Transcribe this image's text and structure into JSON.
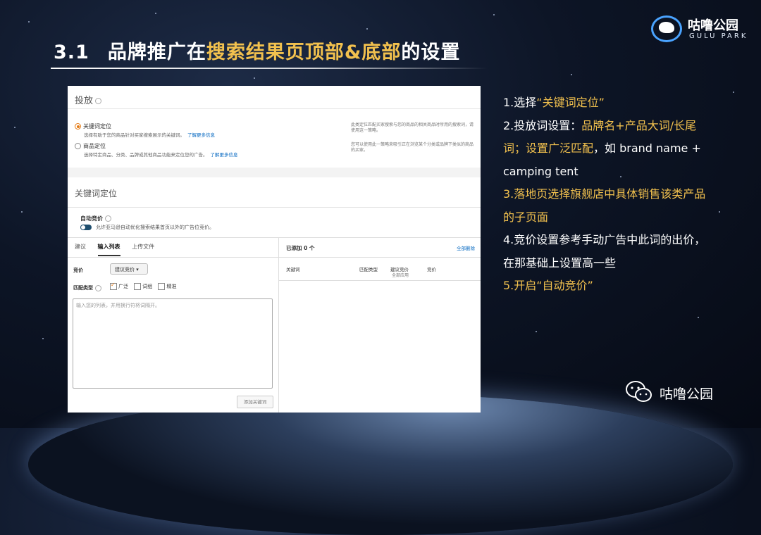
{
  "slide": {
    "title_num": "3.1",
    "title_a": "品牌推广在",
    "title_hl": "搜索结果页顶部&底部",
    "title_b": "的设置"
  },
  "logo": {
    "name": "咕噜公园",
    "sub": "GULU PARK"
  },
  "targeting": {
    "heading": "投放",
    "opt1_label": "关键词定位",
    "opt1_desc": "选择有助于您的商品针对买家搜索展示的关键词。",
    "opt2_label": "商品定位",
    "opt2_desc": "选择特定商品、分类、品牌或其他商品功能来定位您的广告。",
    "learn_more": "了解更多信息",
    "note1": "此类定位匹配买家搜索与您的商品的相关商品时所用的搜索词，请使用这一策略。",
    "note2": "您可以使用此一策略来吸引正在浏览某个分类或品牌下类似的商品的买家。"
  },
  "keyword": {
    "heading": "关键词定位",
    "autobid_label": "自动竞价",
    "autobid_desc": "允许亚马逊自动优化搜索结果首页以外的广告位竞价。",
    "tabs": [
      "建议",
      "输入列表",
      "上传文件"
    ],
    "bid_label": "竞价",
    "bid_value": "建议竞价",
    "match_label": "匹配类型",
    "match_types": [
      "广泛",
      "词组",
      "精准"
    ],
    "textarea_placeholder": "输入您的列表，并用换行符将词隔开。",
    "add_button": "添加关键词",
    "added_label": "已添加 0 个",
    "remove_all": "全部删除",
    "columns": [
      "关键词",
      "匹配类型",
      "建议竞价",
      "竞价"
    ],
    "col_sub": "全部应用"
  },
  "steps": {
    "s1_a": "1.选择",
    "s1_b": "“关键词定位”",
    "s2_a": "2.投放词设置：",
    "s2_b": "品牌名+产品大词/长尾词；设置广泛匹配",
    "s2_c": "，如 brand name + camping tent",
    "s3": "3.落地页选择旗舰店中具体销售该类产品的子页面",
    "s4": "4.竞价设置参考手动广告中此词的出价，在那基础上设置高一些",
    "s5": "5.开启“自动竞价”"
  },
  "footer": {
    "brand": "咕噜公园"
  },
  "colors": {
    "accent": "#f2c14e",
    "amazon_orange": "#e47911",
    "link_blue": "#0066c0"
  }
}
